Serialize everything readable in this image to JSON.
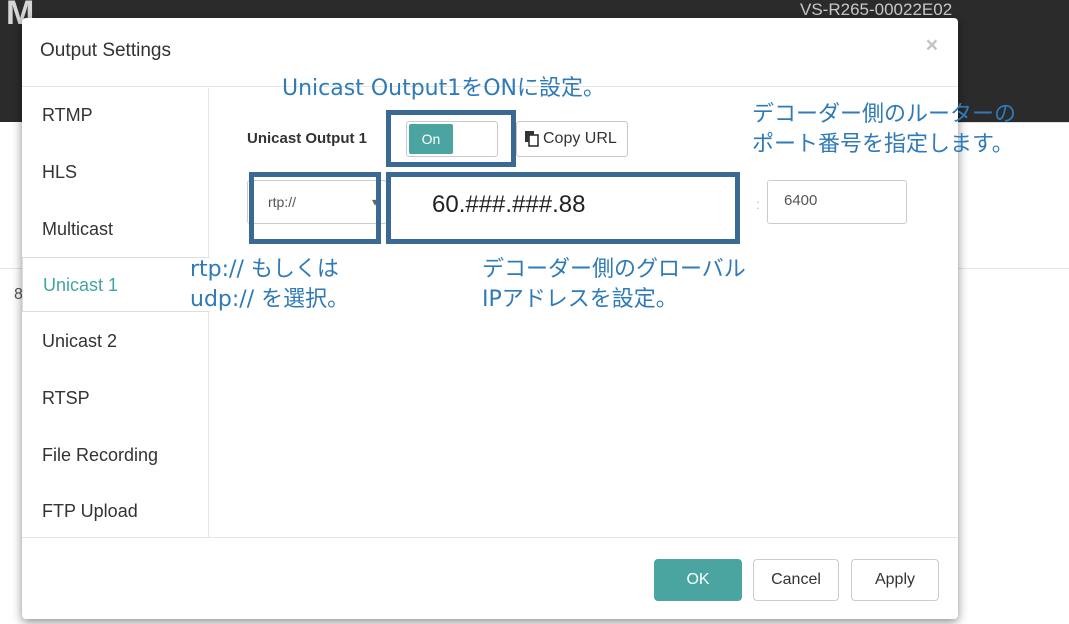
{
  "background": {
    "logo": "M",
    "device_name": "VS-R265-00022E02",
    "side_digit": "8"
  },
  "modal": {
    "title": "Output Settings",
    "close_label": "×"
  },
  "sidebar": {
    "items": [
      {
        "label": "RTMP"
      },
      {
        "label": "HLS"
      },
      {
        "label": "Multicast"
      },
      {
        "label": "Unicast 1",
        "active": true
      },
      {
        "label": "Unicast 2"
      },
      {
        "label": "RTSP"
      },
      {
        "label": "File Recording"
      },
      {
        "label": "FTP Upload"
      }
    ]
  },
  "unicast": {
    "output_label": "Unicast Output 1",
    "toggle_state": "On",
    "copy_url_label": "Copy URL",
    "protocol_value": "rtp://",
    "ip_value": "60.###.###.88",
    "port_separator": ":",
    "port_value": "6400"
  },
  "footer": {
    "ok_label": "OK",
    "cancel_label": "Cancel",
    "apply_label": "Apply"
  },
  "annotations": {
    "toggle_note": "Unicast Output1をONに設定。",
    "port_note": "デコーダー側のルーターの\nポート番号を指定します。",
    "protocol_note": "rtp:// もしくは\nudp:// を選択。",
    "ip_note": "デコーダー側のグローバル\nIPアドレスを設定。"
  },
  "colors": {
    "accent": "#4aa5a1",
    "annotation_box": "#3a6a94",
    "annotation_text": "#2f7ab8"
  }
}
